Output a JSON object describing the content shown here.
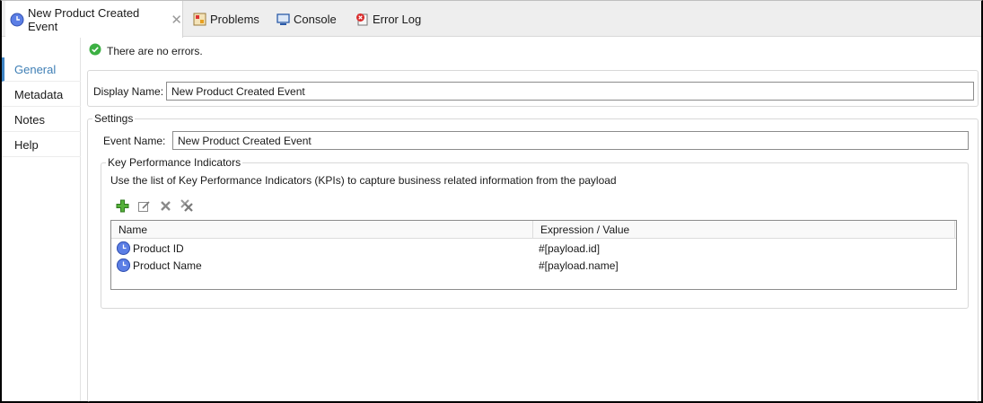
{
  "tabs": [
    {
      "label": "New Product Created Event",
      "icon": "event-clock-icon",
      "active": true
    },
    {
      "label": "Problems",
      "icon": "problems-icon"
    },
    {
      "label": "Console",
      "icon": "console-icon"
    },
    {
      "label": "Error Log",
      "icon": "error-log-icon"
    }
  ],
  "sidebar": {
    "items": [
      {
        "label": "General",
        "active": true
      },
      {
        "label": "Metadata"
      },
      {
        "label": "Notes"
      },
      {
        "label": "Help"
      }
    ]
  },
  "status": {
    "text": "There are no errors.",
    "icon": "check-circle-icon"
  },
  "display_name": {
    "label": "Display Name:",
    "value": "New Product Created Event"
  },
  "settings": {
    "title": "Settings",
    "event_name": {
      "label": "Event Name:",
      "value": "New Product Created Event"
    },
    "kpi": {
      "title": "Key Performance Indicators",
      "description": "Use the list of Key Performance Indicators (KPIs) to capture business related information from the payload",
      "toolbar_icons": [
        "add-icon",
        "edit-icon",
        "delete-icon",
        "delete-all-icon"
      ],
      "columns": [
        "Name",
        "Expression / Value"
      ],
      "rows": [
        {
          "name": "Product ID",
          "expression": "#[payload.id]"
        },
        {
          "name": "Product Name",
          "expression": "#[payload.name]"
        }
      ]
    }
  },
  "colors": {
    "accent": "#3f84c4",
    "kpi_icon": "#4a6fd6",
    "success": "#3cb043"
  }
}
